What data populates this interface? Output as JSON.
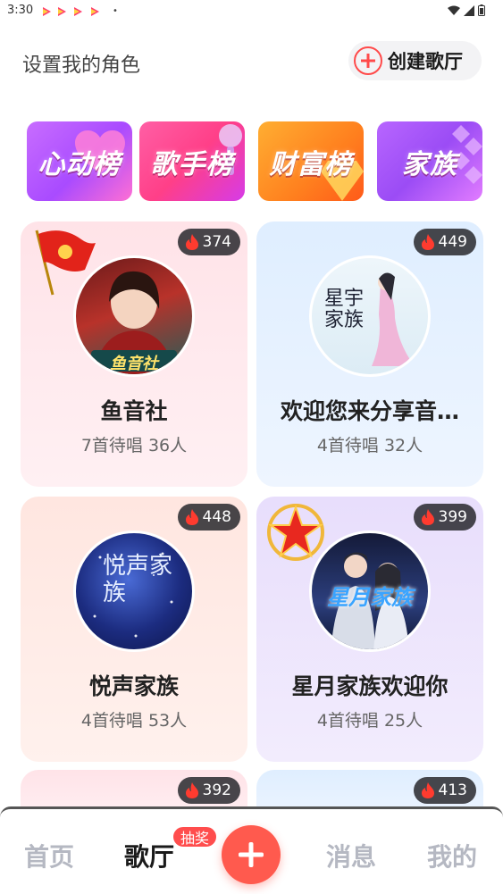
{
  "status_bar": {
    "time": "3:30",
    "dot": "•"
  },
  "header": {
    "role_link": "设置我的角色",
    "create_label": "创建歌厅"
  },
  "banners": [
    {
      "label": "心动榜",
      "icon": "heart-icon"
    },
    {
      "label": "歌手榜",
      "icon": "microphone-icon"
    },
    {
      "label": "财富榜",
      "icon": "diamond-icon"
    },
    {
      "label": "家族",
      "icon": "grid-icon"
    }
  ],
  "rooms": [
    {
      "heat": "374",
      "title": "鱼音社",
      "meta": "7首待唱 36人",
      "avatar_text": "鱼音社",
      "badge": "flag-badge"
    },
    {
      "heat": "449",
      "title": "欢迎您来分享音…",
      "meta": "4首待唱 32人",
      "avatar_text": "星宇家族"
    },
    {
      "heat": "448",
      "title": "悦声家族",
      "meta": "4首待唱 53人",
      "avatar_text": "悦声家族"
    },
    {
      "heat": "399",
      "title": "星月家族欢迎你",
      "meta": "4首待唱 25人",
      "avatar_text": "星月家族",
      "badge": "star-badge"
    },
    {
      "heat": "392"
    },
    {
      "heat": "413"
    }
  ],
  "bottom_nav": {
    "home": "首页",
    "ktv": "歌厅",
    "badge": "抽奖",
    "messages": "消息",
    "mine": "我的"
  },
  "colors": {
    "accent": "#ff5a4e",
    "badge": "#ff4d4d",
    "heat_bg": "#2a2a2e"
  }
}
